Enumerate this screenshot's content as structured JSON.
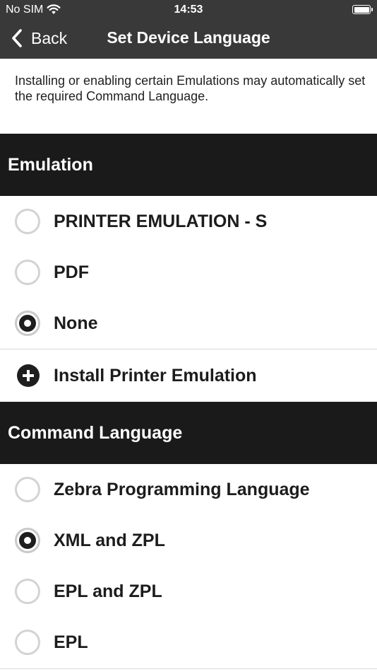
{
  "status_bar": {
    "carrier": "No SIM",
    "time": "14:53"
  },
  "nav": {
    "back_label": "Back",
    "title": "Set Device Language"
  },
  "info_text": "Installing or enabling certain Emulations may automatically set the required Command Language.",
  "emulation": {
    "header": "Emulation",
    "options": [
      {
        "label": "PRINTER EMULATION - S",
        "selected": false
      },
      {
        "label": "PDF",
        "selected": false
      },
      {
        "label": "None",
        "selected": true
      }
    ],
    "install_label": "Install Printer Emulation"
  },
  "command_language": {
    "header": "Command Language",
    "options": [
      {
        "label": "Zebra Programming Language",
        "selected": false
      },
      {
        "label": "XML and ZPL",
        "selected": true
      },
      {
        "label": "EPL and ZPL",
        "selected": false
      },
      {
        "label": "EPL",
        "selected": false
      }
    ]
  },
  "colors": {
    "nav_bg": "#393939",
    "section_bg": "#1a1a1a",
    "divider": "#d9d9d9"
  }
}
